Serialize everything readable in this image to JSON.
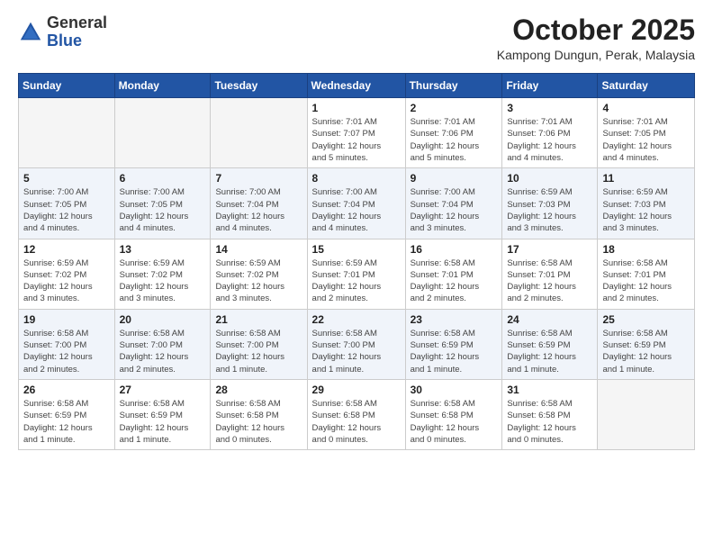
{
  "header": {
    "logo_general": "General",
    "logo_blue": "Blue",
    "month_title": "October 2025",
    "location": "Kampong Dungun, Perak, Malaysia"
  },
  "weekdays": [
    "Sunday",
    "Monday",
    "Tuesday",
    "Wednesday",
    "Thursday",
    "Friday",
    "Saturday"
  ],
  "weeks": [
    [
      {
        "day": "",
        "info": ""
      },
      {
        "day": "",
        "info": ""
      },
      {
        "day": "",
        "info": ""
      },
      {
        "day": "1",
        "info": "Sunrise: 7:01 AM\nSunset: 7:07 PM\nDaylight: 12 hours\nand 5 minutes."
      },
      {
        "day": "2",
        "info": "Sunrise: 7:01 AM\nSunset: 7:06 PM\nDaylight: 12 hours\nand 5 minutes."
      },
      {
        "day": "3",
        "info": "Sunrise: 7:01 AM\nSunset: 7:06 PM\nDaylight: 12 hours\nand 4 minutes."
      },
      {
        "day": "4",
        "info": "Sunrise: 7:01 AM\nSunset: 7:05 PM\nDaylight: 12 hours\nand 4 minutes."
      }
    ],
    [
      {
        "day": "5",
        "info": "Sunrise: 7:00 AM\nSunset: 7:05 PM\nDaylight: 12 hours\nand 4 minutes."
      },
      {
        "day": "6",
        "info": "Sunrise: 7:00 AM\nSunset: 7:05 PM\nDaylight: 12 hours\nand 4 minutes."
      },
      {
        "day": "7",
        "info": "Sunrise: 7:00 AM\nSunset: 7:04 PM\nDaylight: 12 hours\nand 4 minutes."
      },
      {
        "day": "8",
        "info": "Sunrise: 7:00 AM\nSunset: 7:04 PM\nDaylight: 12 hours\nand 4 minutes."
      },
      {
        "day": "9",
        "info": "Sunrise: 7:00 AM\nSunset: 7:04 PM\nDaylight: 12 hours\nand 3 minutes."
      },
      {
        "day": "10",
        "info": "Sunrise: 6:59 AM\nSunset: 7:03 PM\nDaylight: 12 hours\nand 3 minutes."
      },
      {
        "day": "11",
        "info": "Sunrise: 6:59 AM\nSunset: 7:03 PM\nDaylight: 12 hours\nand 3 minutes."
      }
    ],
    [
      {
        "day": "12",
        "info": "Sunrise: 6:59 AM\nSunset: 7:02 PM\nDaylight: 12 hours\nand 3 minutes."
      },
      {
        "day": "13",
        "info": "Sunrise: 6:59 AM\nSunset: 7:02 PM\nDaylight: 12 hours\nand 3 minutes."
      },
      {
        "day": "14",
        "info": "Sunrise: 6:59 AM\nSunset: 7:02 PM\nDaylight: 12 hours\nand 3 minutes."
      },
      {
        "day": "15",
        "info": "Sunrise: 6:59 AM\nSunset: 7:01 PM\nDaylight: 12 hours\nand 2 minutes."
      },
      {
        "day": "16",
        "info": "Sunrise: 6:58 AM\nSunset: 7:01 PM\nDaylight: 12 hours\nand 2 minutes."
      },
      {
        "day": "17",
        "info": "Sunrise: 6:58 AM\nSunset: 7:01 PM\nDaylight: 12 hours\nand 2 minutes."
      },
      {
        "day": "18",
        "info": "Sunrise: 6:58 AM\nSunset: 7:01 PM\nDaylight: 12 hours\nand 2 minutes."
      }
    ],
    [
      {
        "day": "19",
        "info": "Sunrise: 6:58 AM\nSunset: 7:00 PM\nDaylight: 12 hours\nand 2 minutes."
      },
      {
        "day": "20",
        "info": "Sunrise: 6:58 AM\nSunset: 7:00 PM\nDaylight: 12 hours\nand 2 minutes."
      },
      {
        "day": "21",
        "info": "Sunrise: 6:58 AM\nSunset: 7:00 PM\nDaylight: 12 hours\nand 1 minute."
      },
      {
        "day": "22",
        "info": "Sunrise: 6:58 AM\nSunset: 7:00 PM\nDaylight: 12 hours\nand 1 minute."
      },
      {
        "day": "23",
        "info": "Sunrise: 6:58 AM\nSunset: 6:59 PM\nDaylight: 12 hours\nand 1 minute."
      },
      {
        "day": "24",
        "info": "Sunrise: 6:58 AM\nSunset: 6:59 PM\nDaylight: 12 hours\nand 1 minute."
      },
      {
        "day": "25",
        "info": "Sunrise: 6:58 AM\nSunset: 6:59 PM\nDaylight: 12 hours\nand 1 minute."
      }
    ],
    [
      {
        "day": "26",
        "info": "Sunrise: 6:58 AM\nSunset: 6:59 PM\nDaylight: 12 hours\nand 1 minute."
      },
      {
        "day": "27",
        "info": "Sunrise: 6:58 AM\nSunset: 6:59 PM\nDaylight: 12 hours\nand 1 minute."
      },
      {
        "day": "28",
        "info": "Sunrise: 6:58 AM\nSunset: 6:58 PM\nDaylight: 12 hours\nand 0 minutes."
      },
      {
        "day": "29",
        "info": "Sunrise: 6:58 AM\nSunset: 6:58 PM\nDaylight: 12 hours\nand 0 minutes."
      },
      {
        "day": "30",
        "info": "Sunrise: 6:58 AM\nSunset: 6:58 PM\nDaylight: 12 hours\nand 0 minutes."
      },
      {
        "day": "31",
        "info": "Sunrise: 6:58 AM\nSunset: 6:58 PM\nDaylight: 12 hours\nand 0 minutes."
      },
      {
        "day": "",
        "info": ""
      }
    ]
  ]
}
